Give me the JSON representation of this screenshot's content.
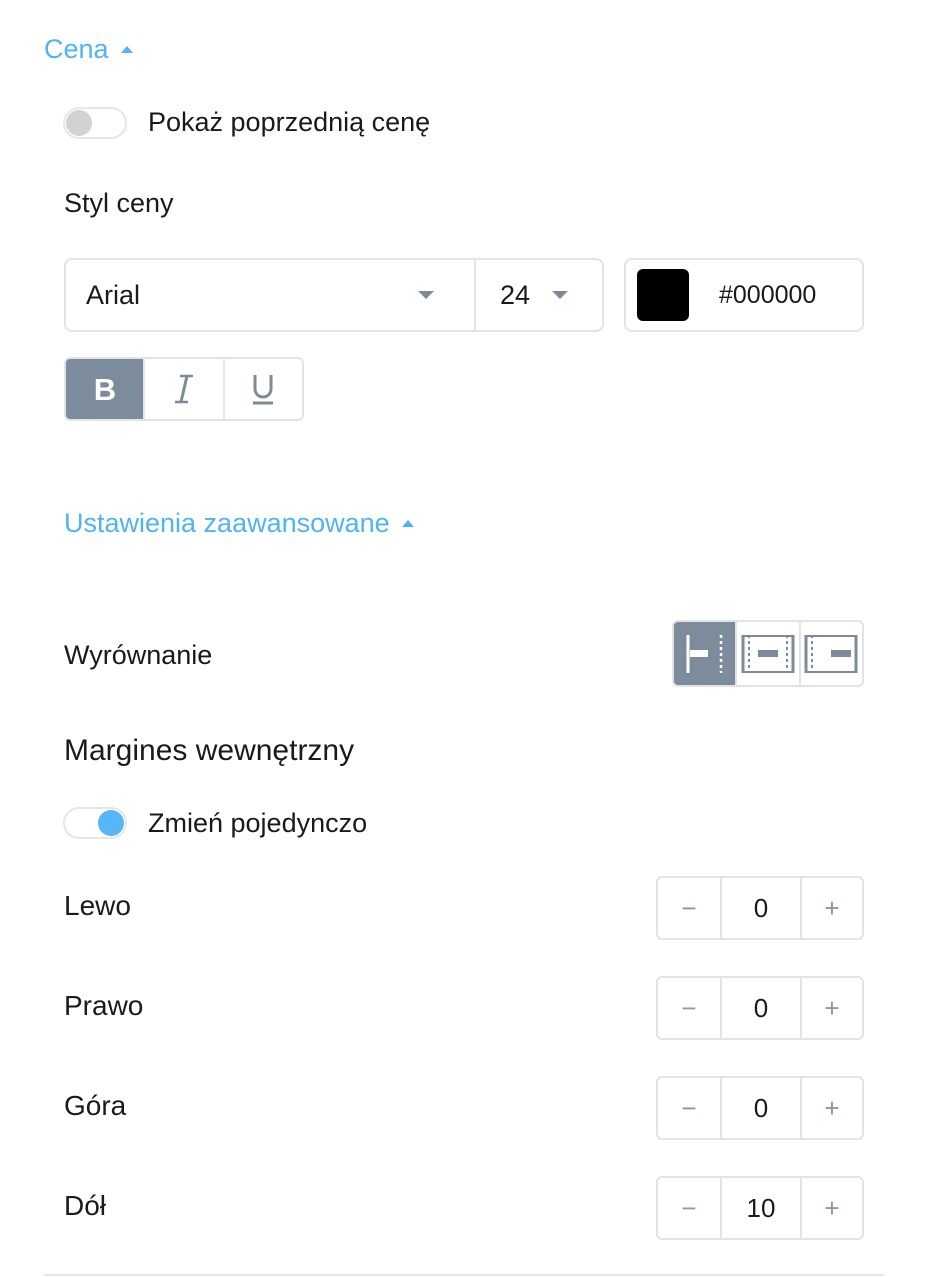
{
  "price_section": {
    "title": "Cena",
    "show_previous_price": {
      "label": "Pokaż poprzednią cenę",
      "enabled": false
    },
    "style_heading": "Styl ceny",
    "font_family": "Arial",
    "font_size": "24",
    "color_hex": "#000000",
    "styles": [
      {
        "name": "bold",
        "glyph": "B",
        "active": true
      },
      {
        "name": "italic",
        "glyph": "I",
        "active": false
      },
      {
        "name": "underline",
        "glyph": "U",
        "active": false
      }
    ]
  },
  "advanced": {
    "title": "Ustawienia zaawansowane",
    "alignment_label": "Wyrównanie",
    "alignment_options": [
      {
        "name": "align-left-icon",
        "active": true
      },
      {
        "name": "align-center-icon",
        "active": false
      },
      {
        "name": "align-right-icon",
        "active": false
      }
    ],
    "padding_heading": "Margines wewnętrzny",
    "individual_toggle": {
      "label": "Zmień pojedynczo",
      "enabled": true
    },
    "padding": {
      "left": {
        "label": "Lewo",
        "value": "0"
      },
      "right": {
        "label": "Prawo",
        "value": "0"
      },
      "top": {
        "label": "Góra",
        "value": "0"
      },
      "bottom": {
        "label": "Dół",
        "value": "10"
      }
    },
    "stepper": {
      "minus": "−",
      "plus": "+"
    }
  },
  "colors": {
    "accent": "#4fb3f6",
    "active_button": "#7d8c9c",
    "border": "#e3e3e3"
  }
}
